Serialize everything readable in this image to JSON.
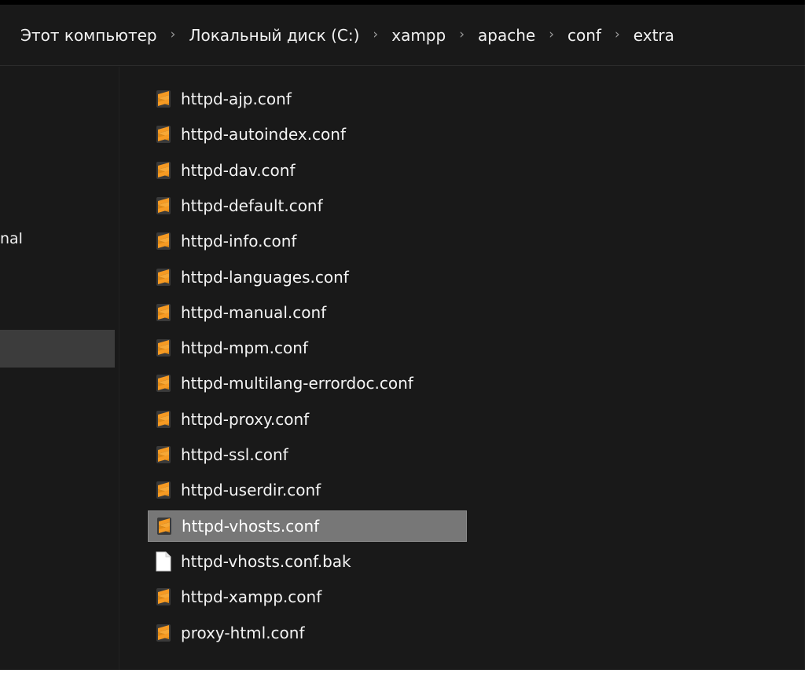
{
  "breadcrumb": [
    "Этот компьютер",
    "Локальный диск (C:)",
    "xampp",
    "apache",
    "conf",
    "extra"
  ],
  "breadcrumb_separator": "›",
  "sidebar": {
    "partial_label": "nal"
  },
  "files": [
    {
      "name": "httpd-ajp.conf",
      "icon": "sublime-text-icon"
    },
    {
      "name": "httpd-autoindex.conf",
      "icon": "sublime-text-icon"
    },
    {
      "name": "httpd-dav.conf",
      "icon": "sublime-text-icon"
    },
    {
      "name": "httpd-default.conf",
      "icon": "sublime-text-icon"
    },
    {
      "name": "httpd-info.conf",
      "icon": "sublime-text-icon"
    },
    {
      "name": "httpd-languages.conf",
      "icon": "sublime-text-icon"
    },
    {
      "name": "httpd-manual.conf",
      "icon": "sublime-text-icon"
    },
    {
      "name": "httpd-mpm.conf",
      "icon": "sublime-text-icon"
    },
    {
      "name": "httpd-multilang-errordoc.conf",
      "icon": "sublime-text-icon"
    },
    {
      "name": "httpd-proxy.conf",
      "icon": "sublime-text-icon"
    },
    {
      "name": "httpd-ssl.conf",
      "icon": "sublime-text-icon"
    },
    {
      "name": "httpd-userdir.conf",
      "icon": "sublime-text-icon"
    },
    {
      "name": "httpd-vhosts.conf",
      "icon": "sublime-text-icon",
      "selected": true
    },
    {
      "name": "httpd-vhosts.conf.bak",
      "icon": "blank-file-icon"
    },
    {
      "name": "httpd-xampp.conf",
      "icon": "sublime-text-icon"
    },
    {
      "name": "proxy-html.conf",
      "icon": "sublime-text-icon"
    }
  ],
  "colors": {
    "background": "#191919",
    "selection": "#777777",
    "sidebar_selection": "#3c3c3c",
    "sublime_orange": "#f59a23",
    "text": "#f4f4f4"
  }
}
